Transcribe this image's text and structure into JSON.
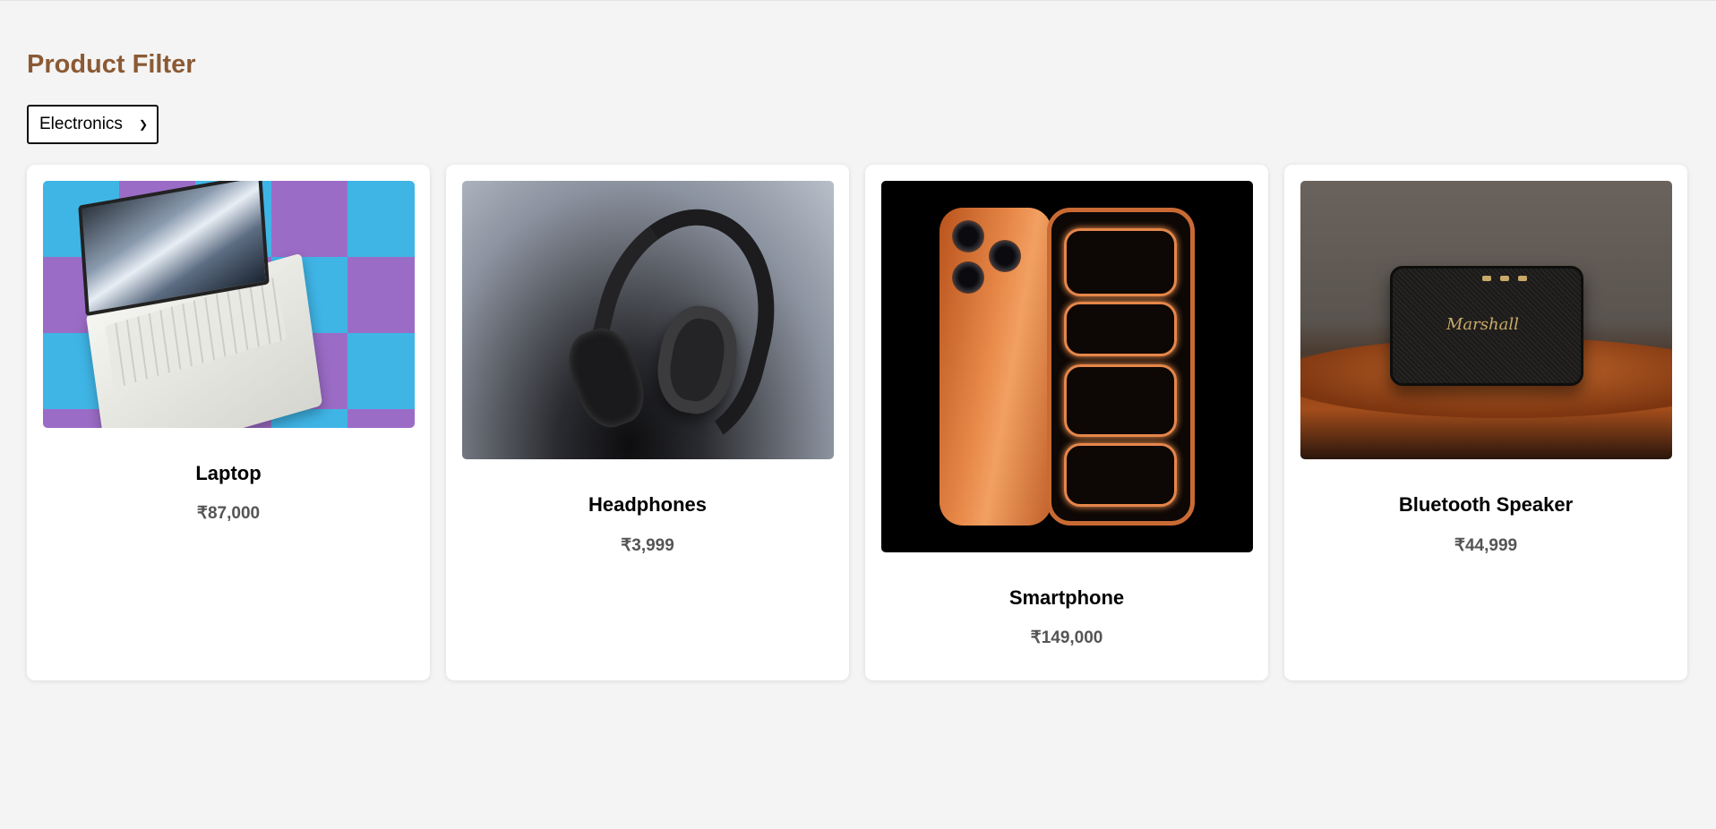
{
  "page": {
    "title": "Product Filter"
  },
  "filter": {
    "selected": "Electronics"
  },
  "products": [
    {
      "name": "Laptop",
      "price": "₹87,000",
      "image": "laptop-photo"
    },
    {
      "name": "Headphones",
      "price": "₹3,999",
      "image": "headphones-photo"
    },
    {
      "name": "Smartphone",
      "price": "₹149,000",
      "image": "smartphone-photo"
    },
    {
      "name": "Bluetooth Speaker",
      "price": "₹44,999",
      "image": "speaker-photo",
      "brand_mark": "Marshall"
    }
  ],
  "colors": {
    "title": "#8b5a34",
    "background": "#f4f4f4",
    "card": "#ffffff",
    "price": "#555555"
  }
}
